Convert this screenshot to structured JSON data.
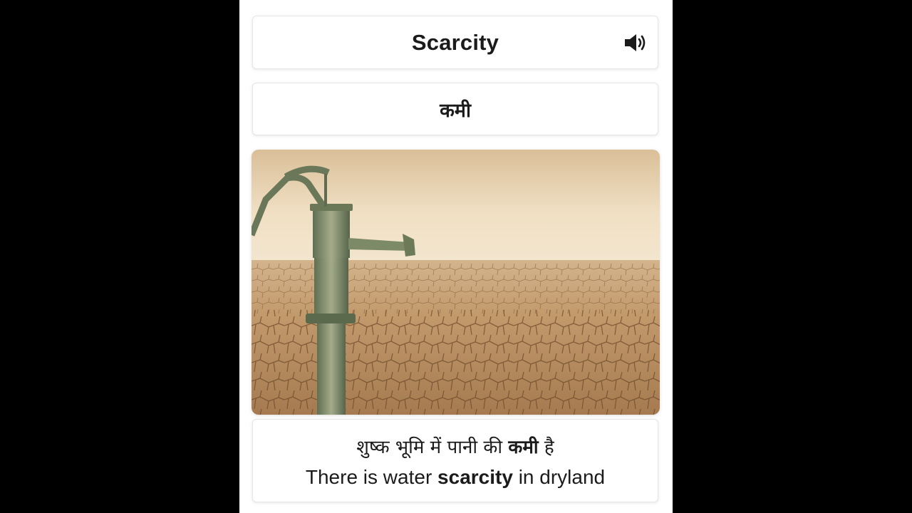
{
  "flashcard": {
    "word": "Scarcity",
    "translation": "कमी",
    "speaker_icon": "speaker-volume-icon",
    "image": {
      "description_icon": "hand-pump-dry-land-image"
    },
    "sentence_hindi": {
      "before": "शुष्क भूमि में पानी की ",
      "highlight": "कमी",
      "after": " है"
    },
    "sentence_english": {
      "before": "There is water ",
      "highlight": "scarcity",
      "after": " in dryland"
    }
  },
  "colors": {
    "background": "#000000",
    "card": "#ffffff",
    "text": "#1b1b1b",
    "sky": "#e9d6b4",
    "ground": "#b98f63"
  }
}
